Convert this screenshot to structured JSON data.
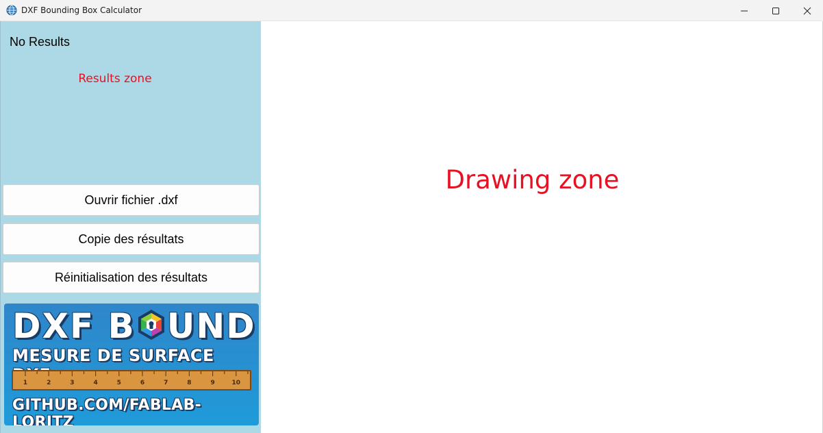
{
  "window": {
    "title": "DXF Bounding Box Calculator",
    "icon": "globe-app-icon",
    "controls": [
      "minimize-icon",
      "maximize-icon",
      "close-icon"
    ]
  },
  "sidebar": {
    "status": "No Results",
    "results_placeholder": "Results zone",
    "buttons": {
      "open": "Ouvrir fichier .dxf",
      "copy": "Copie des résultats",
      "reset": "Réinitialisation des résultats"
    },
    "banner": {
      "title_left": "DXF B",
      "title_right": "UND",
      "subtitle": "MESURE DE SURFACE DXF",
      "ruler_marks": [
        "1",
        "2",
        "3",
        "4",
        "5",
        "6",
        "7",
        "8",
        "9",
        "10"
      ],
      "url": "GITHUB.COM/FABLAB-LORITZ"
    }
  },
  "main": {
    "drawing_placeholder": "Drawing zone"
  },
  "colors": {
    "sidebar_bg": "#add8e6",
    "placeholder_red": "#e81123",
    "banner_blue": "#2f86c9",
    "ruler_wood": "#d9953f"
  }
}
